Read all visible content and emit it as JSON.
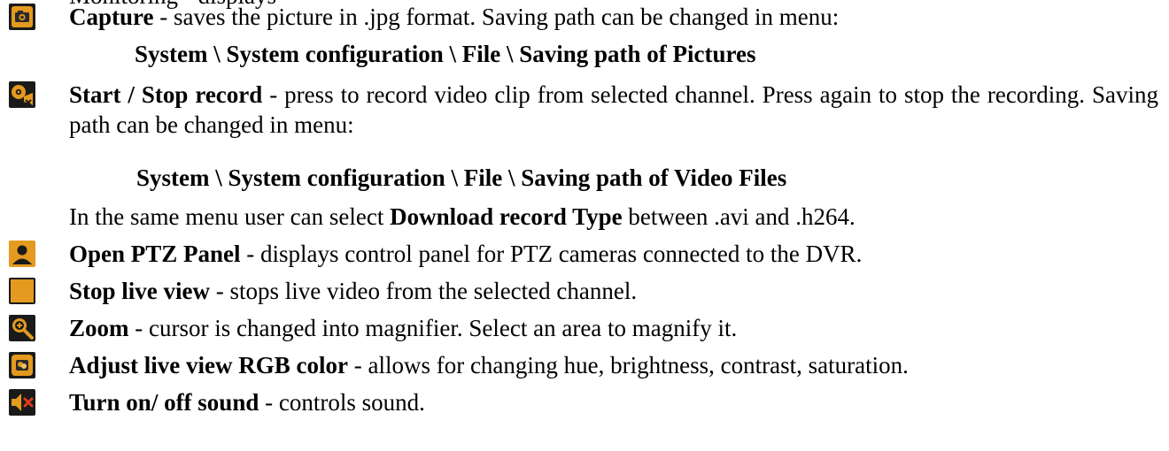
{
  "top_fragment": "Monitoring - displays",
  "items": [
    {
      "icon": "camera-icon",
      "title": "Capture",
      "text": " - saves the picture in .jpg format. Saving path can be changed in menu:"
    },
    {
      "path": "System \\ System configuration \\ File \\ Saving path of Pictures"
    },
    {
      "icon": "video-record-icon",
      "title": "Start / Stop record",
      "text": " - press to record video clip from selected channel. Press again to stop the recording. Saving path can be changed in menu:"
    },
    {
      "path": "System \\ System configuration \\ File \\ Saving path of Video Files"
    },
    {
      "pre": "In the same menu user can select ",
      "bold": "Download record Type",
      "post": " between .avi and .h264."
    },
    {
      "icon": "ptz-person-icon",
      "title": "Open PTZ Panel",
      "text": " - displays control panel for PTZ cameras connected to the DVR."
    },
    {
      "icon": "stop-square-icon",
      "title": "Stop live view",
      "text": " - stops live video from the selected channel."
    },
    {
      "icon": "zoom-magnifier-icon",
      "title": "Zoom",
      "text": " - cursor is changed into magnifier. Select an area to magnify it."
    },
    {
      "icon": "rgb-color-icon",
      "title": "Adjust live view RGB color",
      "text": " - allows for changing hue, brightness, contrast, saturation."
    },
    {
      "icon": "sound-mute-icon",
      "title": "Turn on/ off sound",
      "text": " - controls sound."
    }
  ],
  "colors": {
    "icon_orange": "#e39a1e",
    "icon_dark": "#1a1a1a"
  }
}
